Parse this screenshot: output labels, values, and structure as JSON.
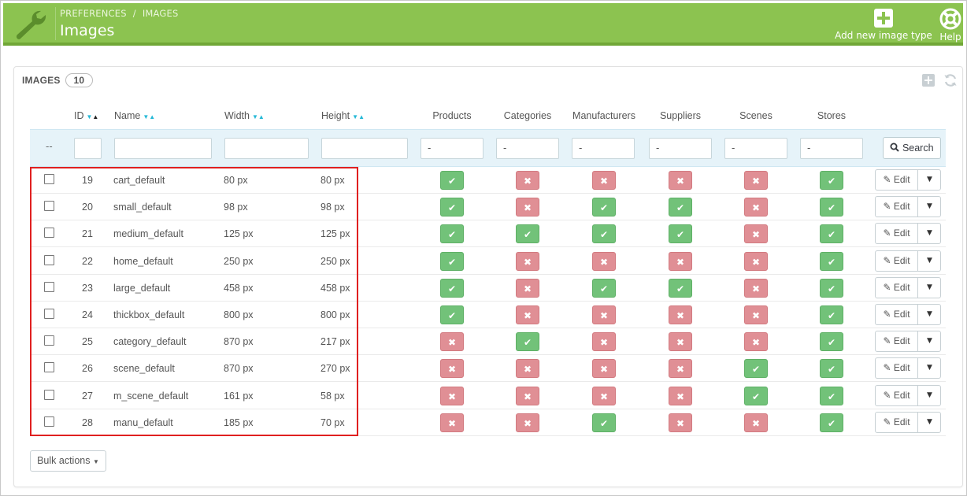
{
  "header": {
    "breadcrumb": [
      "PREFERENCES",
      "IMAGES"
    ],
    "breadcrumb_separator": "/",
    "title": "Images",
    "add_label": "Add new image type",
    "help_label": "Help",
    "color": "#8cc350"
  },
  "panel": {
    "heading": "IMAGES",
    "count": "10"
  },
  "columns": {
    "id": "ID",
    "name": "Name",
    "width": "Width",
    "height": "Height",
    "products": "Products",
    "categories": "Categories",
    "manufacturers": "Manufacturers",
    "suppliers": "Suppliers",
    "scenes": "Scenes",
    "stores": "Stores"
  },
  "filters": {
    "dash": "--",
    "select_value": "-",
    "search_label": "Search"
  },
  "rows": [
    {
      "id": "19",
      "name": "cart_default",
      "width": "80 px",
      "height": "80 px",
      "flags": [
        true,
        false,
        false,
        false,
        false,
        true
      ]
    },
    {
      "id": "20",
      "name": "small_default",
      "width": "98 px",
      "height": "98 px",
      "flags": [
        true,
        false,
        true,
        true,
        false,
        true
      ]
    },
    {
      "id": "21",
      "name": "medium_default",
      "width": "125 px",
      "height": "125 px",
      "flags": [
        true,
        true,
        true,
        true,
        false,
        true
      ]
    },
    {
      "id": "22",
      "name": "home_default",
      "width": "250 px",
      "height": "250 px",
      "flags": [
        true,
        false,
        false,
        false,
        false,
        true
      ]
    },
    {
      "id": "23",
      "name": "large_default",
      "width": "458 px",
      "height": "458 px",
      "flags": [
        true,
        false,
        true,
        true,
        false,
        true
      ]
    },
    {
      "id": "24",
      "name": "thickbox_default",
      "width": "800 px",
      "height": "800 px",
      "flags": [
        true,
        false,
        false,
        false,
        false,
        true
      ]
    },
    {
      "id": "25",
      "name": "category_default",
      "width": "870 px",
      "height": "217 px",
      "flags": [
        false,
        true,
        false,
        false,
        false,
        true
      ]
    },
    {
      "id": "26",
      "name": "scene_default",
      "width": "870 px",
      "height": "270 px",
      "flags": [
        false,
        false,
        false,
        false,
        true,
        true
      ]
    },
    {
      "id": "27",
      "name": "m_scene_default",
      "width": "161 px",
      "height": "58 px",
      "flags": [
        false,
        false,
        false,
        false,
        true,
        true
      ]
    },
    {
      "id": "28",
      "name": "manu_default",
      "width": "185 px",
      "height": "70 px",
      "flags": [
        false,
        false,
        true,
        false,
        false,
        true
      ]
    }
  ],
  "row_actions": {
    "edit_label": "Edit"
  },
  "footer": {
    "bulk_label": "Bulk actions"
  },
  "colors": {
    "yes": "#72c279",
    "no": "#e08f95",
    "highlight": "#e02020"
  }
}
